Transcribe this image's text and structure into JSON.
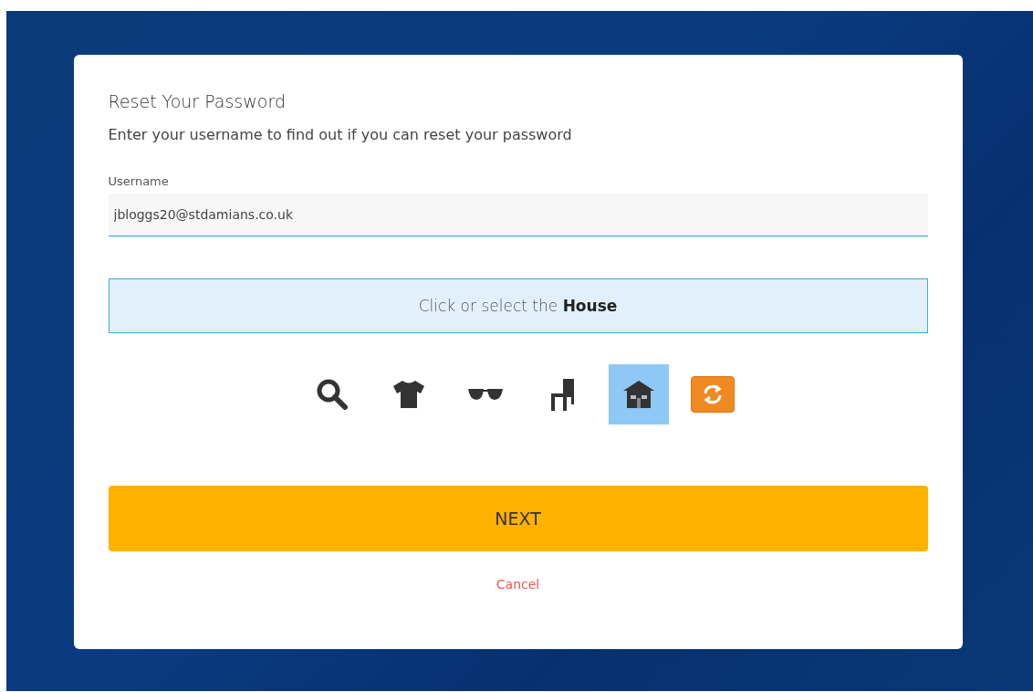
{
  "dialog": {
    "title": "Reset Your Password",
    "subtitle": "Enter your username to find out if you can reset your password"
  },
  "username": {
    "label": "Username",
    "value": "jbloggs20@stdamians.co.uk"
  },
  "captcha": {
    "prompt": "Click or select the **House**",
    "icons": [
      {
        "kind": "search",
        "selected": false
      },
      {
        "kind": "shirt",
        "selected": false
      },
      {
        "kind": "glasses",
        "selected": false
      },
      {
        "kind": "chair",
        "selected": false
      },
      {
        "kind": "house",
        "selected": true
      }
    ]
  },
  "next_button": "NEXT",
  "cancel_link": "Cancel"
}
